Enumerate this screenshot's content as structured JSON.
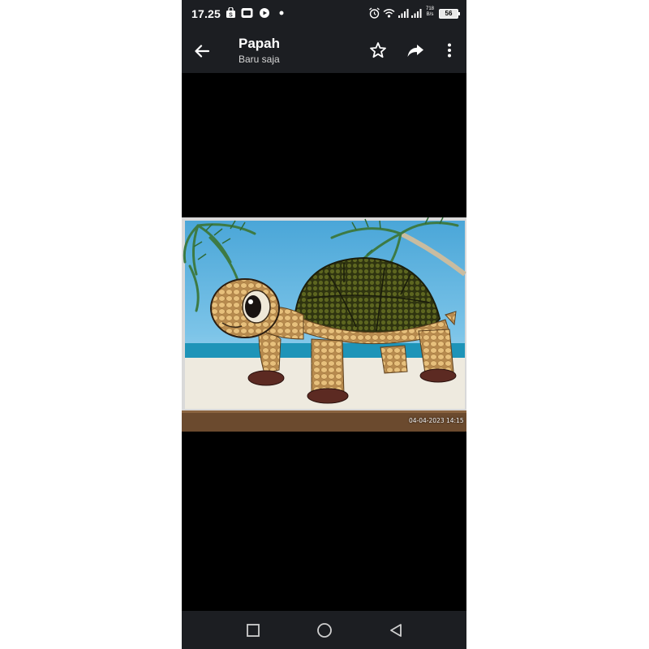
{
  "status_bar": {
    "time": "17.25",
    "battery": "56",
    "net_speed_top": "718",
    "net_speed_bottom": "B/s",
    "icons": [
      "shop-notification-icon",
      "whatsapp-business-icon",
      "record-icon",
      "more-dot-icon",
      "alarm-icon",
      "wifi-icon",
      "signal-icon",
      "signal-icon",
      "battery-icon"
    ]
  },
  "app_bar": {
    "title": "Papah",
    "subtitle": "Baru saja",
    "actions": [
      "star-icon",
      "forward-icon",
      "more-vert-icon"
    ]
  },
  "photo": {
    "subject": "turtle-seed-mosaic",
    "timestamp": "04-04-2023 14:15"
  },
  "nav_bar": {
    "buttons": [
      "recents-square-icon",
      "home-circle-icon",
      "back-triangle-icon"
    ]
  },
  "colors": {
    "bars": "#1c1e22",
    "viewer_bg": "#000000"
  }
}
